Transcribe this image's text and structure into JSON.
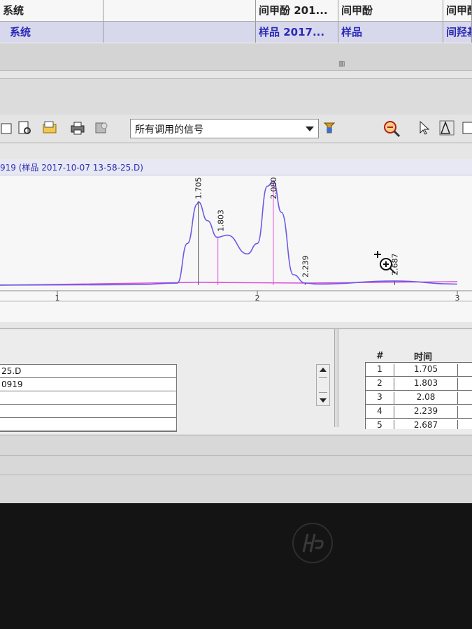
{
  "top_table": {
    "row1": [
      "系统",
      "",
      "间甲酚 201...",
      "间甲酚",
      "间甲酚"
    ],
    "row2": [
      "系统",
      "",
      "样品 2017...",
      "样品",
      "间羟基"
    ]
  },
  "toolbar": {
    "signal_select": "所有调用的信号",
    "icons": [
      "open-file-icon",
      "print-preview-icon",
      "folder-icon",
      "printer-icon",
      "report-icon",
      "annotate-icon",
      "zoom-in-icon",
      "zoom-out-icon",
      "pointer-icon",
      "baseline-icon"
    ]
  },
  "chart": {
    "header": "919 (样品 2017-10-07 13-58-25.D)",
    "x_ticks": [
      "1",
      "2",
      "3"
    ],
    "peak_labels": [
      "1.705",
      "1.803",
      "2.080",
      "2.239",
      "2.687"
    ]
  },
  "chart_data": {
    "type": "line",
    "title": "",
    "xlabel": "",
    "ylabel": "",
    "xlim": [
      0.7,
      3.0
    ],
    "ylim": [
      0,
      100
    ],
    "series": [
      {
        "x": [
          0.7,
          1.4,
          1.6,
          1.65,
          1.7,
          1.705,
          1.75,
          1.8,
          1.85,
          1.95,
          2.0,
          2.05,
          2.08,
          2.12,
          2.18,
          2.239,
          2.3,
          2.687,
          3.0
        ],
        "y": [
          0,
          0.5,
          2,
          40,
          78,
          80,
          62,
          46,
          48,
          30,
          40,
          95,
          100,
          70,
          10,
          2,
          1,
          4,
          1
        ]
      }
    ],
    "peaks": [
      {
        "time": 1.705,
        "label": "1.705"
      },
      {
        "time": 1.803,
        "label": "1.803"
      },
      {
        "time": 2.08,
        "label": "2.080"
      },
      {
        "time": 2.239,
        "label": "2.239"
      },
      {
        "time": 2.687,
        "label": "2.687"
      }
    ]
  },
  "left_table": {
    "rows": [
      "25.D",
      "0919",
      "",
      "",
      ""
    ]
  },
  "peak_table": {
    "headers": [
      "#",
      "时间"
    ],
    "rows": [
      {
        "num": "1",
        "time": "1.705"
      },
      {
        "num": "2",
        "time": "1.803"
      },
      {
        "num": "3",
        "time": "2.08"
      },
      {
        "num": "4",
        "time": "2.239"
      },
      {
        "num": "5",
        "time": "2.687"
      }
    ]
  },
  "colors": {
    "trace": "#6a5ae8",
    "baseline": "#e04ad8",
    "header_text": "#2b2bb0",
    "highlight": "#f4c25a"
  },
  "bezel": {
    "logo": "hp"
  }
}
